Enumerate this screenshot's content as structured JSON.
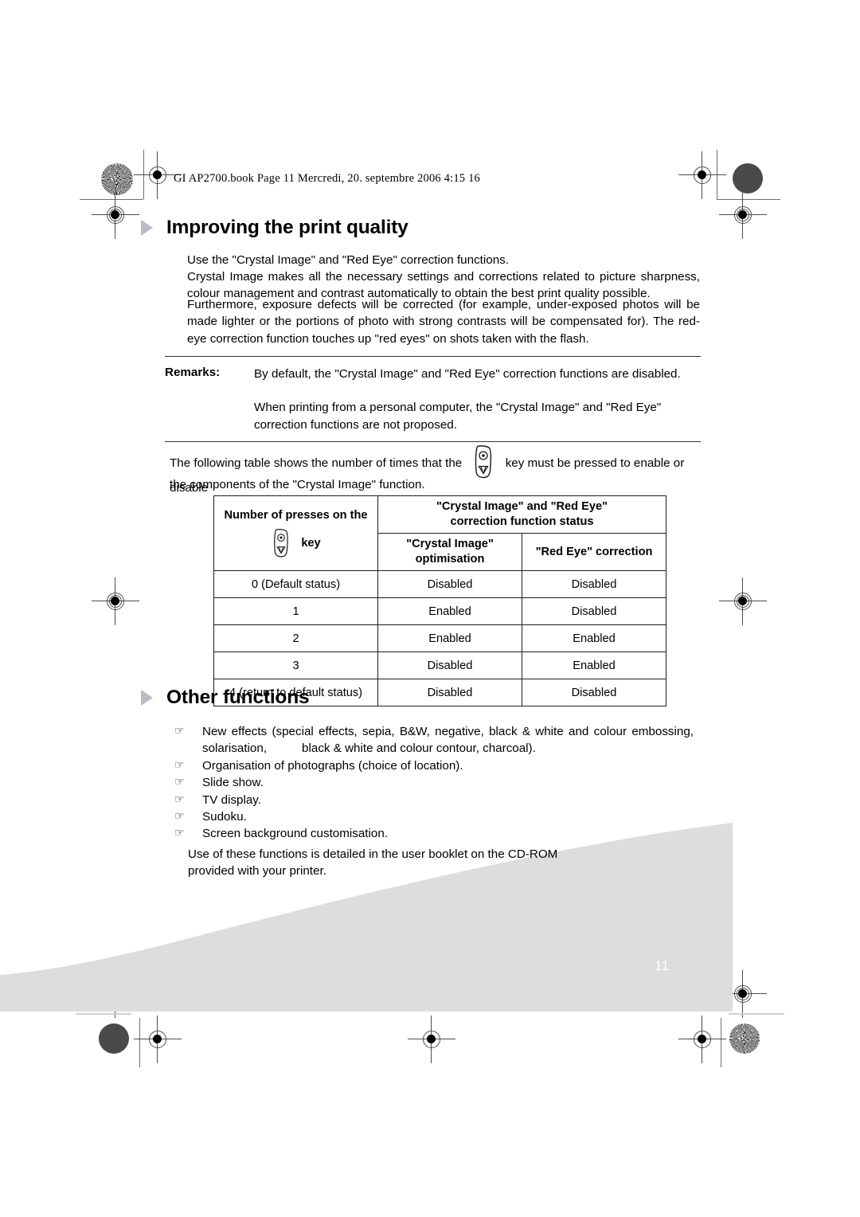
{
  "document": {
    "header_line": "GI AP2700.book  Page 11  Mercredi, 20. septembre 2006  4:15 16",
    "page_number": "11"
  },
  "sections": [
    {
      "id": "improving-print-quality",
      "title": "Improving the print quality",
      "paragraphs": [
        "Use the \"Crystal Image\" and \"Red Eye\" correction functions.",
        "Crystal Image makes all the necessary settings and corrections related to picture sharpness, colour management and contrast automatically to obtain the best print quality possible.",
        "Furthermore, exposure defects will be corrected (for example, under-exposed photos will be made lighter or the portions of photo with strong contrasts will be compensated for). The red-eye correction function touches up \"red eyes\" on shots taken with the flash."
      ]
    },
    {
      "id": "other-functions",
      "title": "Other functions"
    }
  ],
  "remarks": {
    "label": "Remarks:",
    "items": [
      "By default, the \"Crystal Image\" and \"Red Eye\" correction functions are disabled.",
      "When printing from a personal computer, the \"Crystal Image\" and \"Red Eye\" correction functions are not proposed."
    ]
  },
  "intro": {
    "before_key": "The following table shows the number of times that the",
    "after_key": "key must be pressed to enable or disable",
    "second_line": "the components of the \"Crystal Image\" function."
  },
  "table": {
    "header": {
      "col_a_line1": "Number of presses on the",
      "col_a_key_label": "key",
      "col_bc_title_line1": "\"Crystal Image\" and \"Red Eye\"",
      "col_bc_title_line2": "correction function status",
      "col_b_line1": "\"Crystal Image\"",
      "col_b_line2": "optimisation",
      "col_c": "\"Red Eye\" correction"
    },
    "rows": [
      {
        "presses": "0 (Default status)",
        "crystal": "Disabled",
        "redeye": "Disabled"
      },
      {
        "presses": "1",
        "crystal": "Enabled",
        "redeye": "Disabled"
      },
      {
        "presses": "2",
        "crystal": "Enabled",
        "redeye": "Enabled"
      },
      {
        "presses": "3",
        "crystal": "Disabled",
        "redeye": "Enabled"
      },
      {
        "presses": "4 (return to default status)",
        "crystal": "Disabled",
        "redeye": "Disabled"
      }
    ]
  },
  "other_functions": {
    "bullet_glyph": "☞",
    "items": [
      {
        "text_a": "New effects (special effects, sepia, B&W, negative, black & white and colour embossing, solarisation,",
        "text_b": "black & white and colour contour, charcoal)."
      },
      {
        "text_a": "Organisation of photographs (choice of location)."
      },
      {
        "text_a": "Slide show."
      },
      {
        "text_a": "TV display."
      },
      {
        "text_a": "Sudoku."
      },
      {
        "text_a": "Screen background customisation."
      }
    ],
    "closing": "Use of these functions is detailed in the user booklet on the CD-ROM provided with your printer."
  },
  "colors": {
    "triangle_bullet": "#b9bcc4",
    "swoosh_grey": "#dddddd",
    "reg_mark": "#4c4c4c",
    "page_number_text": "#ffffff"
  }
}
